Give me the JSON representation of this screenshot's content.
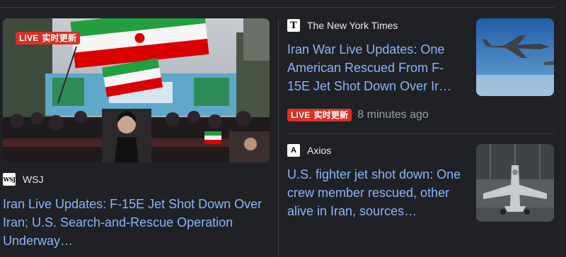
{
  "main": {
    "live_label": "LIVE",
    "live_sub": "实时更新",
    "source": "WSJ",
    "logo_text": "WSJ",
    "headline": "Iran Live Updates: F-15E Jet Shot Down Over Iran; U.S. Search-and-Rescue Operation Underway…",
    "image_desc_icon": "rally-photo"
  },
  "side": [
    {
      "source": "The New York Times",
      "logo_text": "T",
      "headline": "Iran War Live Updates: One American Rescued From F-15E Jet Shot Down Over Ir…",
      "live_label": "LIVE",
      "live_sub": "实时更新",
      "time": "8 minutes ago",
      "thumb_icon": "fighter-jet-sky-photo"
    },
    {
      "source": "Axios",
      "logo_text": "A",
      "headline": "U.S. fighter jet shot down: One crew member rescued, other alive in Iran, sources…",
      "thumb_icon": "fighter-jet-hangar-photo"
    }
  ],
  "colors": {
    "background": "#202124",
    "link": "#8ab4f8",
    "live": "#d93025",
    "muted": "#9aa0a6"
  }
}
